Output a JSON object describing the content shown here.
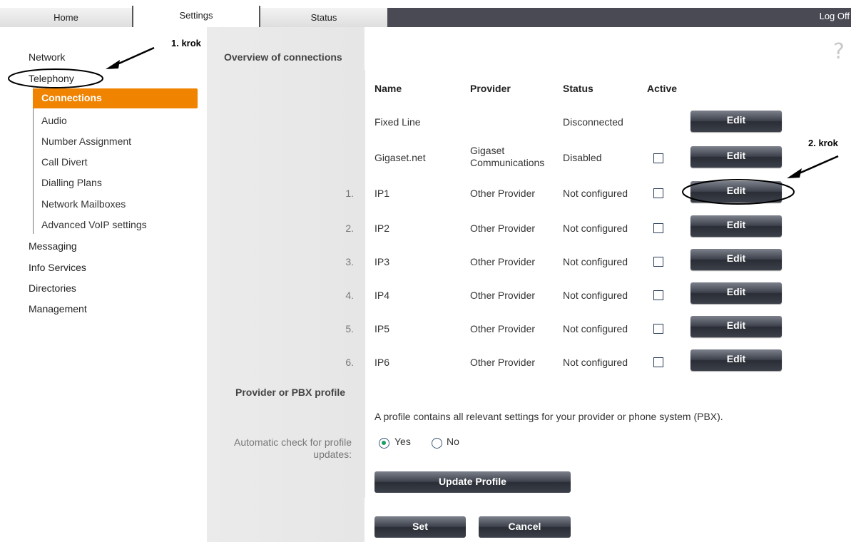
{
  "tabs": [
    "Home",
    "Settings",
    "Status"
  ],
  "logoff": "Log Off",
  "nav": {
    "items": [
      "Network",
      "Telephony",
      "Messaging",
      "Info Services",
      "Directories",
      "Management"
    ],
    "telephony_sub": [
      "Connections",
      "Audio",
      "Number Assignment",
      "Call Divert",
      "Dialling Plans",
      "Network Mailboxes",
      "Advanced VoIP settings"
    ]
  },
  "main": {
    "section_title": "Overview of connections",
    "headers": {
      "name": "Name",
      "provider": "Provider",
      "status": "Status",
      "active": "Active"
    },
    "rows": [
      {
        "num": "",
        "name": "Fixed Line",
        "provider": "",
        "status": "Disconnected",
        "active": null,
        "edit": "Edit"
      },
      {
        "num": "",
        "name": "Gigaset.net",
        "provider": "Gigaset Communications",
        "status": "Disabled",
        "active": false,
        "edit": "Edit"
      },
      {
        "num": "1.",
        "name": "IP1",
        "provider": "Other Provider",
        "status": "Not configured",
        "active": false,
        "edit": "Edit"
      },
      {
        "num": "2.",
        "name": "IP2",
        "provider": "Other Provider",
        "status": "Not configured",
        "active": false,
        "edit": "Edit"
      },
      {
        "num": "3.",
        "name": "IP3",
        "provider": "Other Provider",
        "status": "Not configured",
        "active": false,
        "edit": "Edit"
      },
      {
        "num": "4.",
        "name": "IP4",
        "provider": "Other Provider",
        "status": "Not configured",
        "active": false,
        "edit": "Edit"
      },
      {
        "num": "5.",
        "name": "IP5",
        "provider": "Other Provider",
        "status": "Not configured",
        "active": false,
        "edit": "Edit"
      },
      {
        "num": "6.",
        "name": "IP6",
        "provider": "Other Provider",
        "status": "Not configured",
        "active": false,
        "edit": "Edit"
      }
    ],
    "profile_title": "Provider or PBX profile",
    "profile_desc": "A profile contains all relevant settings for your provider or phone system (PBX).",
    "auto_check_label": "Automatic check for profile updates:",
    "radio_yes": "Yes",
    "radio_no": "No",
    "radio_selected": "Yes",
    "update_profile": "Update Profile",
    "set": "Set",
    "cancel": "Cancel"
  },
  "help_icon": "?",
  "annotations": {
    "step1": "1. krok",
    "step2": "2. krok"
  },
  "colors": {
    "accent": "#f08300",
    "button_dark": "#2a2d35",
    "topbar": "#4a4a55"
  }
}
